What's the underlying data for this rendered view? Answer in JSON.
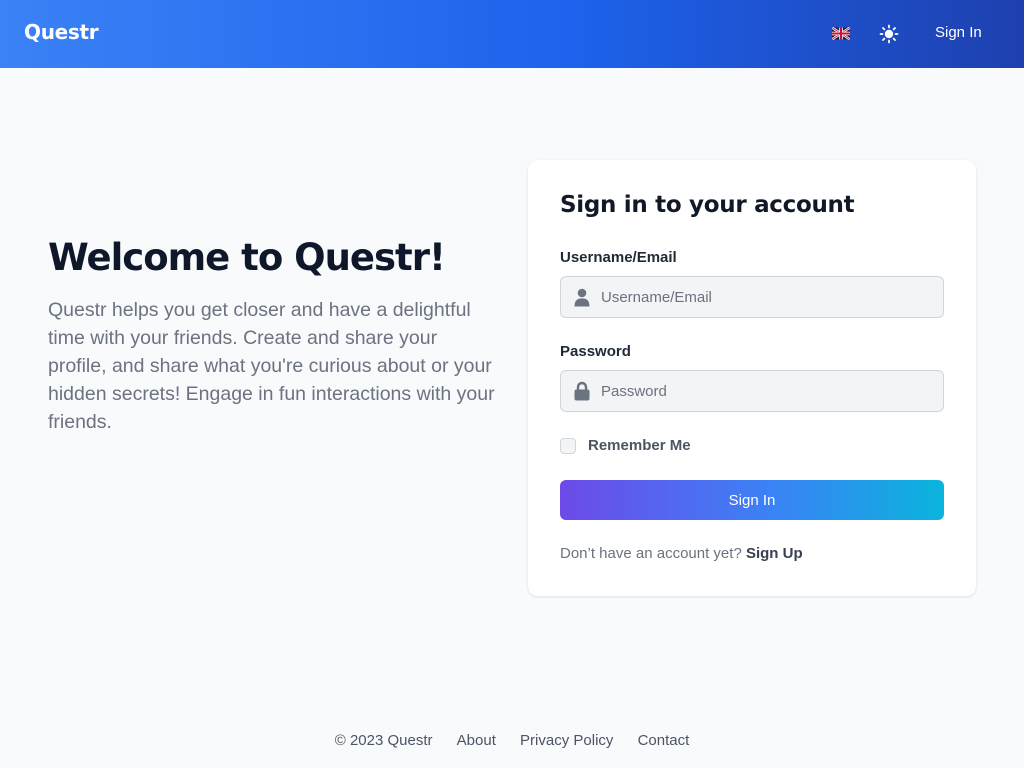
{
  "header": {
    "brand": "Questr",
    "language_icon": "uk-flag-icon",
    "theme_icon": "sun-icon",
    "signin_label": "Sign In"
  },
  "hero": {
    "title": "Welcome to Questr!",
    "description": "Questr helps you get closer and have a delightful time with your friends. Create and share your profile, and share what you're curious about or your hidden secrets! Engage in fun interactions with your friends."
  },
  "login": {
    "title": "Sign in to your account",
    "username_label": "Username/Email",
    "username_placeholder": "Username/Email",
    "username_value": "",
    "username_icon": "user-icon",
    "password_label": "Password",
    "password_placeholder": "Password",
    "password_value": "",
    "password_icon": "lock-icon",
    "remember_label": "Remember Me",
    "remember_checked": false,
    "submit_label": "Sign In",
    "signup_prompt": "Don’t have an account yet?",
    "signup_link": "Sign Up"
  },
  "footer": {
    "copyright": "© 2023 Questr",
    "links": [
      "About",
      "Privacy Policy",
      "Contact"
    ]
  },
  "colors": {
    "header_gradient_start": "#3b82f6",
    "header_gradient_end": "#1e40af",
    "button_gradient_start": "#6d4ae8",
    "button_gradient_end": "#0ab4dc",
    "page_background": "#f8fafc"
  }
}
